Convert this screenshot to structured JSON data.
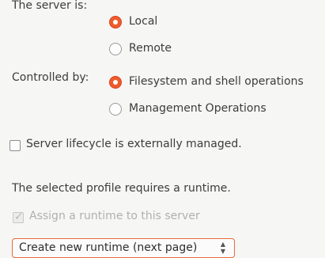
{
  "server_location": {
    "label": "The server is:",
    "options": [
      {
        "label": "Local",
        "checked": true
      },
      {
        "label": "Remote",
        "checked": false
      }
    ]
  },
  "controlled_by": {
    "label": "Controlled by:",
    "options": [
      {
        "label": "Filesystem and shell operations",
        "checked": true
      },
      {
        "label": "Management Operations",
        "checked": false
      }
    ]
  },
  "lifecycle": {
    "label": "Server lifecycle is externally managed.",
    "checked": false
  },
  "runtime": {
    "message": "The selected profile requires a runtime.",
    "assign_label": "Assign a runtime to this server",
    "assign_checked": true,
    "assign_enabled": false,
    "select_value": "Create new runtime (next page)"
  }
}
